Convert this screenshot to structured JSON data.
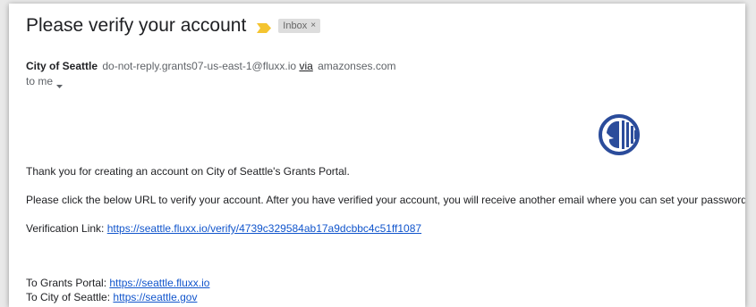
{
  "email": {
    "subject": "Please verify your account",
    "label": "Inbox",
    "label_close": "×",
    "sender_name": "City of Seattle",
    "sender_email": "do-not-reply.grants07-us-east-1@fluxx.io",
    "via_label": "via",
    "via_domain": "amazonses.com",
    "recipient": "to me"
  },
  "body": {
    "line1": "Thank you for creating an account on City of Seattle's Grants Portal.",
    "line2": "Please click the below URL to verify your account. After you have verified your account, you will receive another email where you can set your password:",
    "verification_label": "Verification Link: ",
    "verification_url": "https://seattle.fluxx.io/verify/4739c329584ab17a9dcbbc4c51ff1087",
    "portal_label": "To Grants Portal: ",
    "portal_url": "https://seattle.fluxx.io",
    "city_label": "To City of Seattle: ",
    "city_url": "https://seattle.gov"
  },
  "colors": {
    "importance": "#f4c430",
    "link": "#1155cc",
    "logo": "#2b4c9b"
  },
  "icons": {
    "importance": "importance-marker-icon",
    "caret": "caret-down-icon",
    "logo": "city-of-seattle-logo"
  }
}
